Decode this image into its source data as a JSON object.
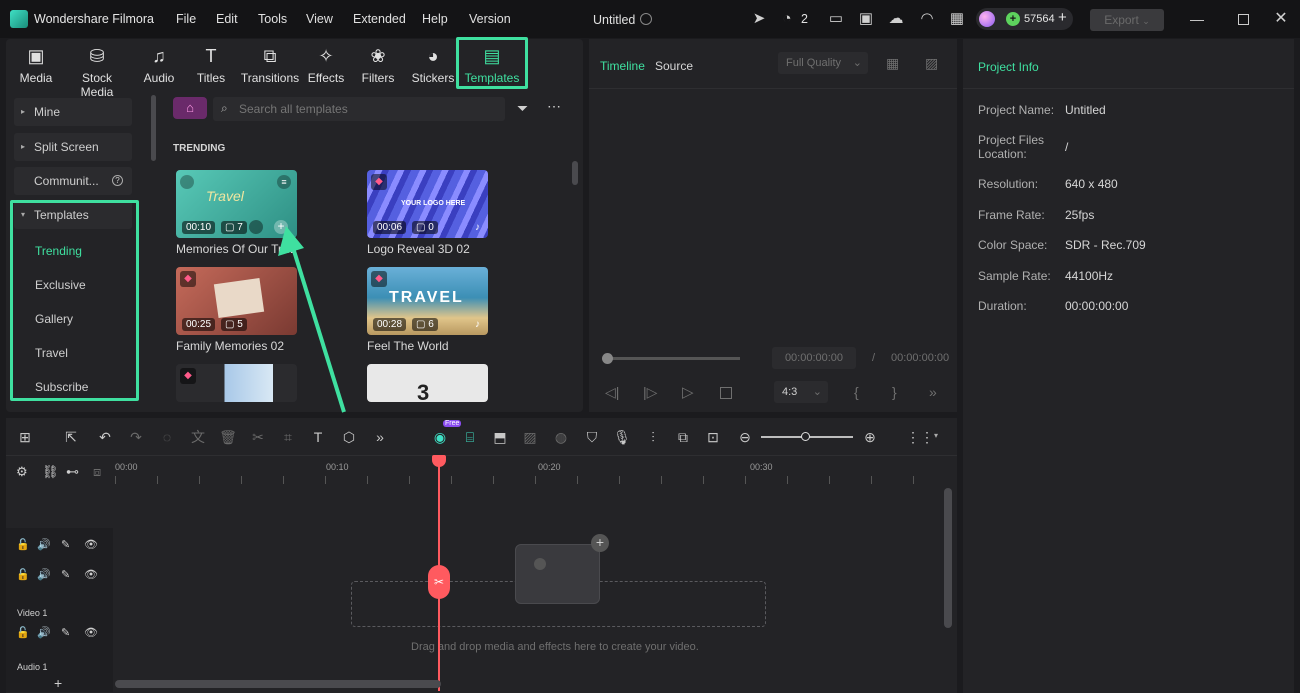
{
  "app": {
    "name": "Wondershare Filmora",
    "project_title": "Untitled"
  },
  "menu": [
    "File",
    "Edit",
    "Tools",
    "View",
    "Extended",
    "Help",
    "Version"
  ],
  "titlebar": {
    "notifications_count": "2",
    "credits": "57564",
    "export_label": "Export"
  },
  "toolbar_tabs": [
    {
      "label": "Media",
      "icon": "media-icon"
    },
    {
      "label": "Stock Media",
      "icon": "stock-media-icon"
    },
    {
      "label": "Audio",
      "icon": "music-note-icon"
    },
    {
      "label": "Titles",
      "icon": "text-t-icon"
    },
    {
      "label": "Transitions",
      "icon": "transition-icon"
    },
    {
      "label": "Effects",
      "icon": "sparkle-icon"
    },
    {
      "label": "Filters",
      "icon": "filter-icon"
    },
    {
      "label": "Stickers",
      "icon": "sticker-icon"
    },
    {
      "label": "Templates",
      "icon": "templates-icon"
    }
  ],
  "sidebar": {
    "items": [
      "Mine",
      "Split Screen",
      "Communit...",
      "Templates"
    ],
    "subitems": [
      "Trending",
      "Exclusive",
      "Gallery",
      "Travel",
      "Subscribe"
    ],
    "active_sub": "Trending"
  },
  "search": {
    "placeholder": "Search all templates"
  },
  "section_title": "TRENDING",
  "templates": [
    {
      "title": "Memories Of Our Trav",
      "duration": "00:10",
      "count": "7"
    },
    {
      "title": "Logo Reveal 3D 02",
      "duration": "00:06",
      "count": "0"
    },
    {
      "title": "Family Memories 02",
      "duration": "00:25",
      "count": "5"
    },
    {
      "title": "Feel The World",
      "duration": "00:28",
      "count": "6"
    }
  ],
  "thumb_text": {
    "logo": "YOUR LOGO HERE",
    "travel": "TRAVEL",
    "countdown": "3"
  },
  "player": {
    "tab_timeline": "Timeline",
    "tab_source": "Source",
    "quality": "Full Quality",
    "time_current": "00:00:00:00",
    "time_separator": "/",
    "time_total": "00:00:00:00",
    "aspect": "4:3"
  },
  "project_info": {
    "title": "Project Info",
    "rows": [
      {
        "label": "Project Name:",
        "value": "Untitled"
      },
      {
        "label": "Project Files Location:",
        "value": "/"
      },
      {
        "label": "Resolution:",
        "value": "640 x 480"
      },
      {
        "label": "Frame Rate:",
        "value": "25fps"
      },
      {
        "label": "Color Space:",
        "value": "SDR - Rec.709"
      },
      {
        "label": "Sample Rate:",
        "value": "44100Hz"
      },
      {
        "label": "Duration:",
        "value": "00:00:00:00"
      }
    ]
  },
  "timeline": {
    "ruler": [
      "00:00",
      "00:10",
      "00:20",
      "00:30"
    ],
    "track_video": "Video 1",
    "track_audio": "Audio 1",
    "drop_hint": "Drag and drop media and effects here to create your video.",
    "ai_badge": "Free"
  },
  "colors": {
    "accent": "#3fe0a0",
    "playhead": "#ff5a5f",
    "bg": "#1b1b1e",
    "panel": "#232326"
  }
}
